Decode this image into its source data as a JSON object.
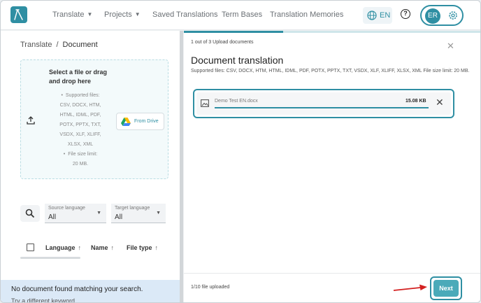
{
  "nav": {
    "items": [
      {
        "label": "Translate",
        "has_chevron": true
      },
      {
        "label": "Projects",
        "has_chevron": true
      },
      {
        "label": "Saved Translations",
        "has_chevron": false
      },
      {
        "label": "Term Bases",
        "has_chevron": false
      },
      {
        "label": "Translation Memories",
        "has_chevron": false
      }
    ],
    "language": "EN",
    "user_initials": "ER",
    "icons": {
      "logo": "lambda-logo-icon",
      "language": "globe-icon",
      "help": "help-circle-icon",
      "settings": "gear-icon"
    }
  },
  "left": {
    "breadcrumb": {
      "root": "Translate",
      "separator": "/",
      "current": "Document"
    },
    "dropzone": {
      "title": "Select a file or drag and drop here",
      "supported_label": "Supported files:",
      "supported_types": "CSV, DOCX, HTM, HTML, IDML, PDF, POTX, PPTX, TXT, VSDX, XLF, XLIFF, XLSX, XML",
      "size_label": "File size limit:",
      "size_value": "20 MB.",
      "drive_button": "From Drive"
    },
    "filters": {
      "source_label": "Source language",
      "source_value": "All",
      "target_label": "Target language",
      "target_value": "All"
    },
    "table": {
      "columns": [
        "Language",
        "Name",
        "File type"
      ]
    },
    "empty_state": {
      "title": "No document found matching your search.",
      "subtitle": "Try a different keyword."
    }
  },
  "right": {
    "step_text": "1 out of 3 Upload documents",
    "step_progress": 0.333,
    "title": "Document translation",
    "supported": "Supported files: CSV, DOCX, HTM, HTML, IDML, PDF, POTX, PPTX, TXT, VSDX, XLF, XLIFF, XLSX, XML File size limit: 20 MB.",
    "file": {
      "name": "Demo Test EN.docx",
      "size": "15.08 KB",
      "progress": 1.0
    },
    "uploaded_text": "1/10 file uploaded",
    "next_label": "Next"
  },
  "colors": {
    "accent": "#2f8fa3",
    "next_button": "#4aaab9",
    "annotation_arrow": "#d32020",
    "empty_bg": "#dbe9f7"
  }
}
